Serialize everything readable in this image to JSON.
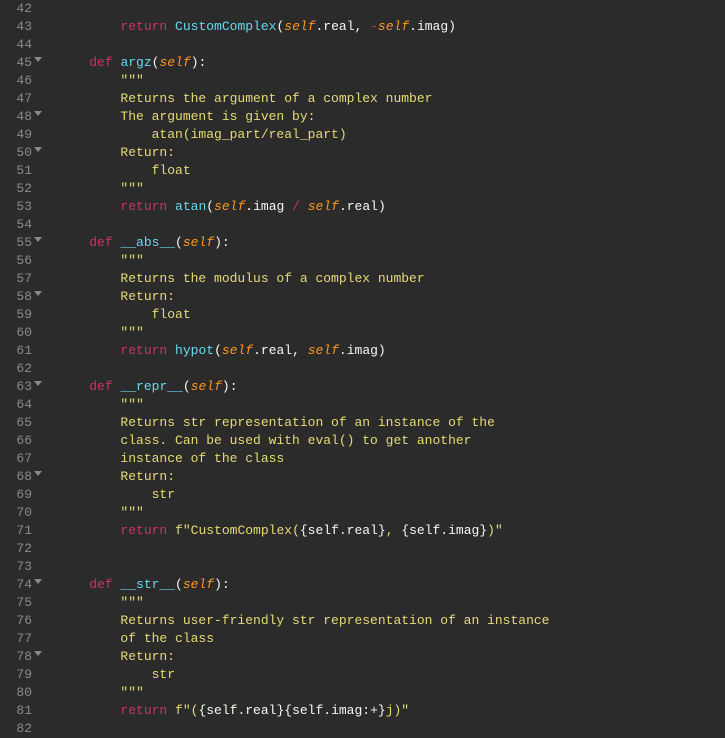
{
  "lines": [
    {
      "n": "42",
      "fold": false,
      "tokens": []
    },
    {
      "n": "43",
      "fold": false,
      "tokens": [
        {
          "t": "        ",
          "c": "txt"
        },
        {
          "t": "return",
          "c": "kw"
        },
        {
          "t": " ",
          "c": "txt"
        },
        {
          "t": "CustomComplex",
          "c": "fn"
        },
        {
          "t": "(",
          "c": "punct"
        },
        {
          "t": "self",
          "c": "self"
        },
        {
          "t": ".real, ",
          "c": "txt"
        },
        {
          "t": "-",
          "c": "op"
        },
        {
          "t": "self",
          "c": "self"
        },
        {
          "t": ".imag)",
          "c": "txt"
        }
      ]
    },
    {
      "n": "44",
      "fold": false,
      "tokens": []
    },
    {
      "n": "45",
      "fold": true,
      "tokens": [
        {
          "t": "    ",
          "c": "txt"
        },
        {
          "t": "def",
          "c": "def"
        },
        {
          "t": " ",
          "c": "txt"
        },
        {
          "t": "argz",
          "c": "fn2"
        },
        {
          "t": "(",
          "c": "punct"
        },
        {
          "t": "self",
          "c": "self"
        },
        {
          "t": "):",
          "c": "txt"
        }
      ]
    },
    {
      "n": "46",
      "fold": false,
      "tokens": [
        {
          "t": "        ",
          "c": "txt"
        },
        {
          "t": "\"\"\"",
          "c": "str"
        }
      ]
    },
    {
      "n": "47",
      "fold": false,
      "tokens": [
        {
          "t": "        Returns the argument of a complex number",
          "c": "str"
        }
      ]
    },
    {
      "n": "48",
      "fold": true,
      "tokens": [
        {
          "t": "        The argument is given by:",
          "c": "str"
        }
      ]
    },
    {
      "n": "49",
      "fold": false,
      "tokens": [
        {
          "t": "            atan(imag_part/real_part)",
          "c": "str"
        }
      ]
    },
    {
      "n": "50",
      "fold": true,
      "tokens": [
        {
          "t": "        Return:",
          "c": "str"
        }
      ]
    },
    {
      "n": "51",
      "fold": false,
      "tokens": [
        {
          "t": "            float",
          "c": "str"
        }
      ]
    },
    {
      "n": "52",
      "fold": false,
      "tokens": [
        {
          "t": "        \"\"\"",
          "c": "str"
        }
      ]
    },
    {
      "n": "53",
      "fold": false,
      "tokens": [
        {
          "t": "        ",
          "c": "txt"
        },
        {
          "t": "return",
          "c": "kw"
        },
        {
          "t": " ",
          "c": "txt"
        },
        {
          "t": "atan",
          "c": "fn"
        },
        {
          "t": "(",
          "c": "punct"
        },
        {
          "t": "self",
          "c": "self"
        },
        {
          "t": ".imag ",
          "c": "txt"
        },
        {
          "t": "/",
          "c": "op"
        },
        {
          "t": " ",
          "c": "txt"
        },
        {
          "t": "self",
          "c": "self"
        },
        {
          "t": ".real)",
          "c": "txt"
        }
      ]
    },
    {
      "n": "54",
      "fold": false,
      "tokens": []
    },
    {
      "n": "55",
      "fold": true,
      "tokens": [
        {
          "t": "    ",
          "c": "txt"
        },
        {
          "t": "def",
          "c": "def"
        },
        {
          "t": " ",
          "c": "txt"
        },
        {
          "t": "__abs__",
          "c": "fn2"
        },
        {
          "t": "(",
          "c": "punct"
        },
        {
          "t": "self",
          "c": "self"
        },
        {
          "t": "):",
          "c": "txt"
        }
      ]
    },
    {
      "n": "56",
      "fold": false,
      "tokens": [
        {
          "t": "        ",
          "c": "txt"
        },
        {
          "t": "\"\"\"",
          "c": "str"
        }
      ]
    },
    {
      "n": "57",
      "fold": false,
      "tokens": [
        {
          "t": "        Returns the modulus of a complex number",
          "c": "str"
        }
      ]
    },
    {
      "n": "58",
      "fold": true,
      "tokens": [
        {
          "t": "        Return:",
          "c": "str"
        }
      ]
    },
    {
      "n": "59",
      "fold": false,
      "tokens": [
        {
          "t": "            float",
          "c": "str"
        }
      ]
    },
    {
      "n": "60",
      "fold": false,
      "tokens": [
        {
          "t": "        \"\"\"",
          "c": "str"
        }
      ]
    },
    {
      "n": "61",
      "fold": false,
      "tokens": [
        {
          "t": "        ",
          "c": "txt"
        },
        {
          "t": "return",
          "c": "kw"
        },
        {
          "t": " ",
          "c": "txt"
        },
        {
          "t": "hypot",
          "c": "fn"
        },
        {
          "t": "(",
          "c": "punct"
        },
        {
          "t": "self",
          "c": "self"
        },
        {
          "t": ".real, ",
          "c": "txt"
        },
        {
          "t": "self",
          "c": "self"
        },
        {
          "t": ".imag)",
          "c": "txt"
        }
      ]
    },
    {
      "n": "62",
      "fold": false,
      "tokens": []
    },
    {
      "n": "63",
      "fold": true,
      "tokens": [
        {
          "t": "    ",
          "c": "txt"
        },
        {
          "t": "def",
          "c": "def"
        },
        {
          "t": " ",
          "c": "txt"
        },
        {
          "t": "__repr__",
          "c": "fn2"
        },
        {
          "t": "(",
          "c": "punct"
        },
        {
          "t": "self",
          "c": "self"
        },
        {
          "t": "):",
          "c": "txt"
        }
      ]
    },
    {
      "n": "64",
      "fold": false,
      "tokens": [
        {
          "t": "        ",
          "c": "txt"
        },
        {
          "t": "\"\"\"",
          "c": "str"
        }
      ]
    },
    {
      "n": "65",
      "fold": false,
      "tokens": [
        {
          "t": "        Returns str representation of an instance of the",
          "c": "str"
        }
      ]
    },
    {
      "n": "66",
      "fold": false,
      "tokens": [
        {
          "t": "        class. Can be used with eval() to get another",
          "c": "str"
        }
      ]
    },
    {
      "n": "67",
      "fold": false,
      "tokens": [
        {
          "t": "        instance of the class",
          "c": "str"
        }
      ]
    },
    {
      "n": "68",
      "fold": true,
      "tokens": [
        {
          "t": "        Return:",
          "c": "str"
        }
      ]
    },
    {
      "n": "69",
      "fold": false,
      "tokens": [
        {
          "t": "            str",
          "c": "str"
        }
      ]
    },
    {
      "n": "70",
      "fold": false,
      "tokens": [
        {
          "t": "        \"\"\"",
          "c": "str"
        }
      ]
    },
    {
      "n": "71",
      "fold": false,
      "tokens": [
        {
          "t": "        ",
          "c": "txt"
        },
        {
          "t": "return",
          "c": "kw"
        },
        {
          "t": " ",
          "c": "txt"
        },
        {
          "t": "f\"CustomComplex(",
          "c": "str"
        },
        {
          "t": "{self.real}",
          "c": "txt"
        },
        {
          "t": ", ",
          "c": "str"
        },
        {
          "t": "{self.imag}",
          "c": "txt"
        },
        {
          "t": ")\"",
          "c": "str"
        }
      ]
    },
    {
      "n": "72",
      "fold": false,
      "tokens": []
    },
    {
      "n": "73",
      "fold": false,
      "tokens": []
    },
    {
      "n": "74",
      "fold": true,
      "tokens": [
        {
          "t": "    ",
          "c": "txt"
        },
        {
          "t": "def",
          "c": "def"
        },
        {
          "t": " ",
          "c": "txt"
        },
        {
          "t": "__str__",
          "c": "fn2"
        },
        {
          "t": "(",
          "c": "punct"
        },
        {
          "t": "self",
          "c": "self"
        },
        {
          "t": "):",
          "c": "txt"
        }
      ]
    },
    {
      "n": "75",
      "fold": false,
      "tokens": [
        {
          "t": "        ",
          "c": "txt"
        },
        {
          "t": "\"\"\"",
          "c": "str"
        }
      ]
    },
    {
      "n": "76",
      "fold": false,
      "tokens": [
        {
          "t": "        Returns user-friendly str representation of an instance",
          "c": "str"
        }
      ]
    },
    {
      "n": "77",
      "fold": false,
      "tokens": [
        {
          "t": "        of the class",
          "c": "str"
        }
      ]
    },
    {
      "n": "78",
      "fold": true,
      "tokens": [
        {
          "t": "        Return:",
          "c": "str"
        }
      ]
    },
    {
      "n": "79",
      "fold": false,
      "tokens": [
        {
          "t": "            str",
          "c": "str"
        }
      ]
    },
    {
      "n": "80",
      "fold": false,
      "tokens": [
        {
          "t": "        \"\"\"",
          "c": "str"
        }
      ]
    },
    {
      "n": "81",
      "fold": false,
      "tokens": [
        {
          "t": "        ",
          "c": "txt"
        },
        {
          "t": "return",
          "c": "kw"
        },
        {
          "t": " ",
          "c": "txt"
        },
        {
          "t": "f\"(",
          "c": "str"
        },
        {
          "t": "{self.real}{self.imag:+}",
          "c": "txt"
        },
        {
          "t": "j)\"",
          "c": "str"
        }
      ]
    },
    {
      "n": "82",
      "fold": false,
      "tokens": []
    }
  ]
}
